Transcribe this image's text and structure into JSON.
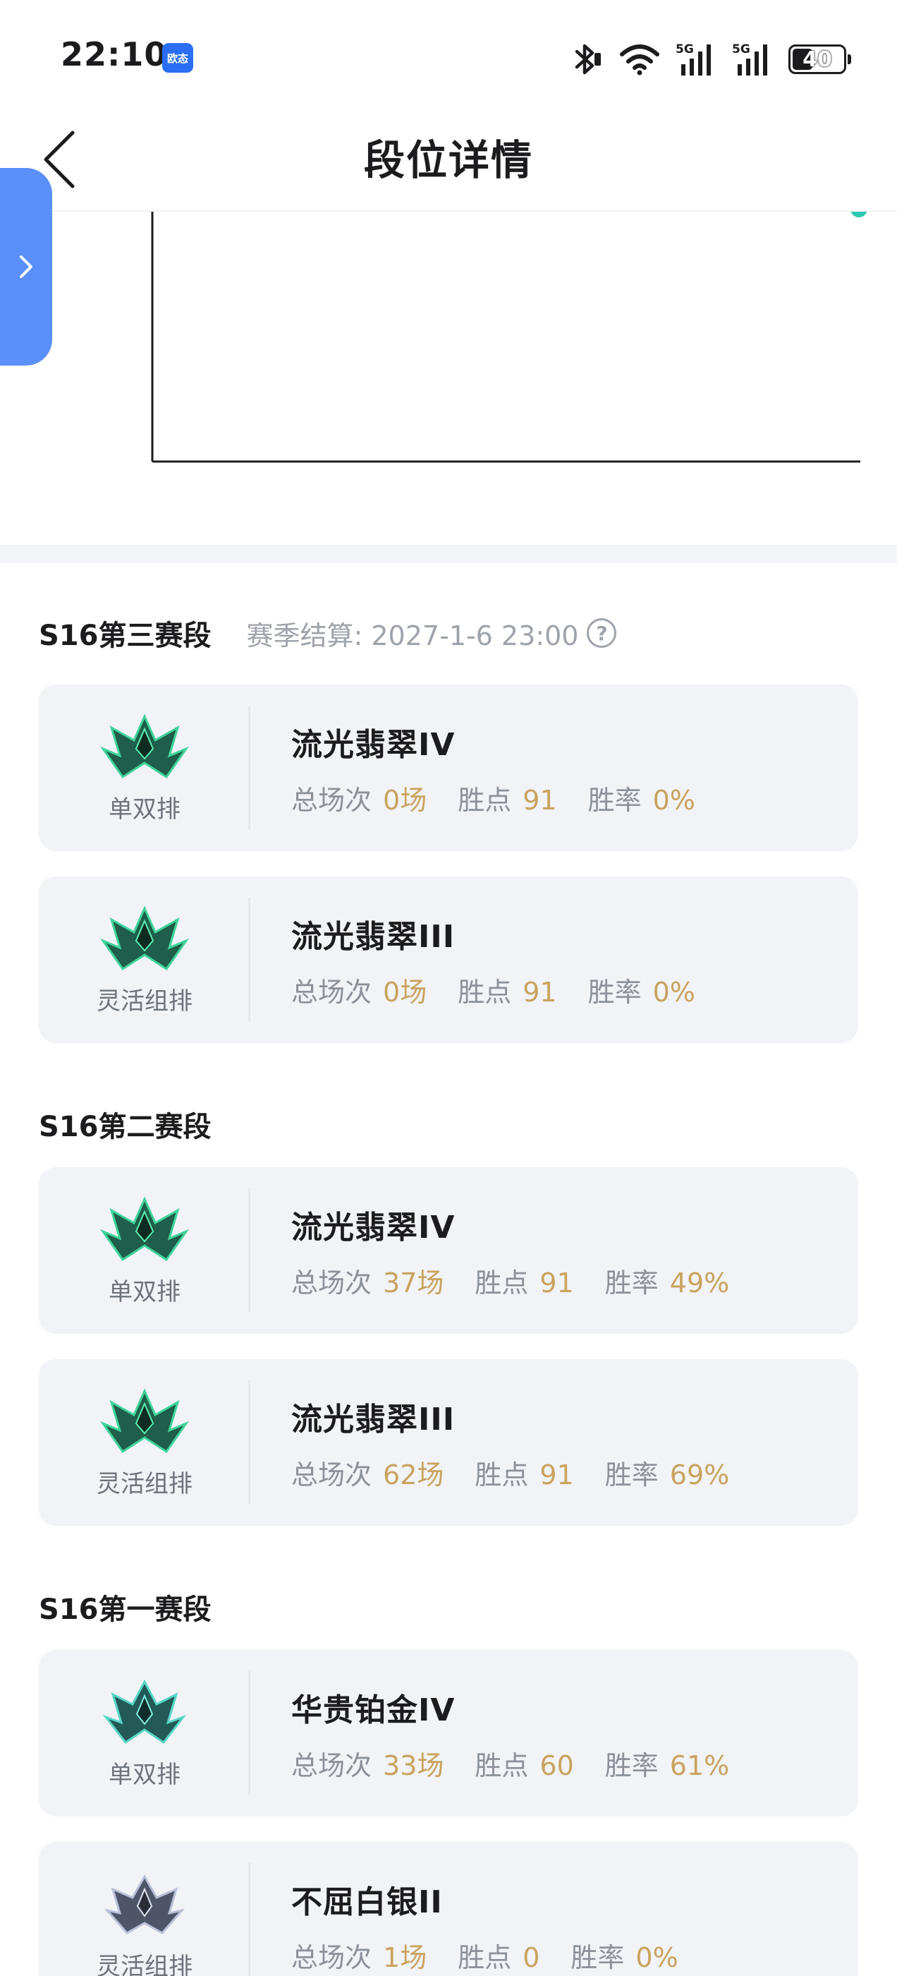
{
  "status_bar": {
    "time": "22:10",
    "app_badge": "欧态",
    "battery": "40"
  },
  "nav": {
    "title": "段位详情"
  },
  "labels": {
    "total_games": "总场次",
    "lp": "胜点",
    "win_rate": "胜率"
  },
  "seasons": [
    {
      "title": "S16第三赛段",
      "settlement": "赛季结算: 2027-1-6 23:00",
      "entries": [
        {
          "queue": "单双排",
          "tier": "流光翡翠IV",
          "games": "0场",
          "lp": "91",
          "win_rate": "0%",
          "emblem": "emerald"
        },
        {
          "queue": "灵活组排",
          "tier": "流光翡翠III",
          "games": "0场",
          "lp": "91",
          "win_rate": "0%",
          "emblem": "emerald"
        }
      ]
    },
    {
      "title": "S16第二赛段",
      "entries": [
        {
          "queue": "单双排",
          "tier": "流光翡翠IV",
          "games": "37场",
          "lp": "91",
          "win_rate": "49%",
          "emblem": "emerald"
        },
        {
          "queue": "灵活组排",
          "tier": "流光翡翠III",
          "games": "62场",
          "lp": "91",
          "win_rate": "69%",
          "emblem": "emerald"
        }
      ]
    },
    {
      "title": "S16第一赛段",
      "entries": [
        {
          "queue": "单双排",
          "tier": "华贵铂金IV",
          "games": "33场",
          "lp": "60",
          "win_rate": "61%",
          "emblem": "platinum"
        },
        {
          "queue": "灵活组排",
          "tier": "不屈白银II",
          "games": "1场",
          "lp": "0",
          "win_rate": "0%",
          "emblem": "silver"
        }
      ]
    }
  ],
  "colors": {
    "accent": "#5b8ff9",
    "value_gold": "#c9a35e",
    "card_bg": "#f1f3f7",
    "chart_dot": "#2bc9b4"
  }
}
